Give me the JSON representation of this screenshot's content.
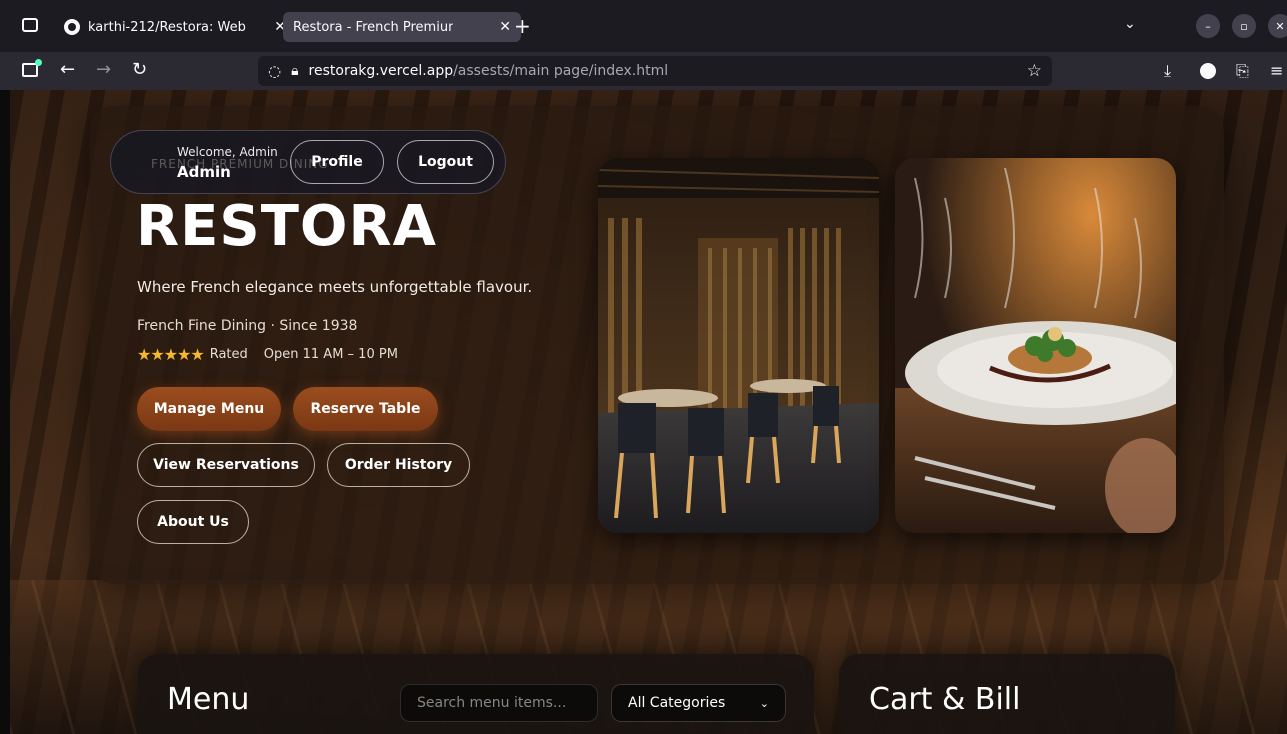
{
  "browser": {
    "tabs": [
      {
        "title": "karthi-212/Restora: Web",
        "icon": "github-icon",
        "active": false
      },
      {
        "title": "Restora - French Premium Re",
        "active": true
      }
    ],
    "new_tab": "+",
    "url_host": "restorakg.vercel.app",
    "url_path": "/assests/main page/index.html"
  },
  "header": {
    "badge": "FRENCH PREMIUM DINING",
    "welcome_label": "Welcome, Admin",
    "user_name": "Admin",
    "profile_label": "Profile",
    "logout_label": "Logout"
  },
  "hero": {
    "title": "RESTORA",
    "tagline": "Where French elegance meets unforgettable flavour.",
    "meta": "French Fine Dining · Since 1938",
    "stars": "★★★★★",
    "rated_label": "Rated",
    "hours": "Open 11 AM – 10 PM"
  },
  "actions": {
    "manage_menu": "Manage Menu",
    "reserve_table": "Reserve Table",
    "view_reservations": "View Reservations",
    "order_history": "Order History",
    "about_us": "About Us"
  },
  "menu_section": {
    "title": "Menu",
    "search_placeholder": "Search menu items...",
    "category_selected": "All Categories"
  },
  "cart_section": {
    "title": "Cart & Bill"
  },
  "colors": {
    "accent": "#9b4d1f",
    "star": "#f5b82e"
  }
}
